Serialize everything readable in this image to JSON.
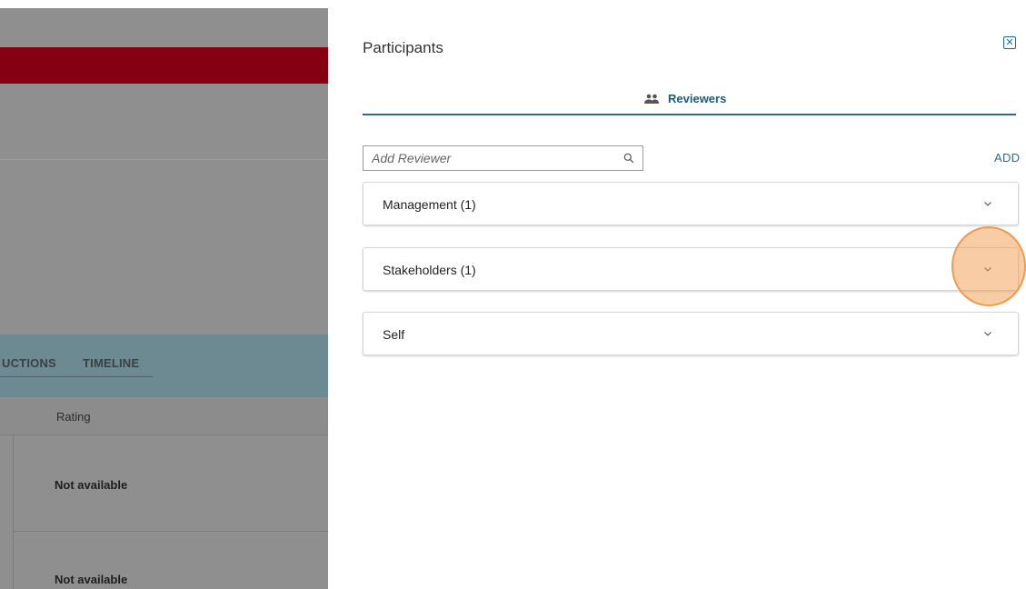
{
  "background_app": {
    "tabs": [
      "UCTIONS",
      "TIMELINE"
    ],
    "table_header": "Rating",
    "rows": [
      "Not available",
      "Not available"
    ],
    "brand_color": "#850012"
  },
  "panel": {
    "title": "Participants",
    "close_icon": "close-icon",
    "tab": {
      "label": "Reviewers",
      "icon": "people-icon"
    },
    "search": {
      "placeholder": "Add Reviewer",
      "value": ""
    },
    "add_label": "ADD",
    "accordions": [
      {
        "label": "Management (1)",
        "expanded": false
      },
      {
        "label": "Stakeholders (1)",
        "expanded": false
      },
      {
        "label": "Self",
        "expanded": false
      }
    ],
    "accent_color": "#2f6d87",
    "highlight_color": "#f29a4a"
  }
}
